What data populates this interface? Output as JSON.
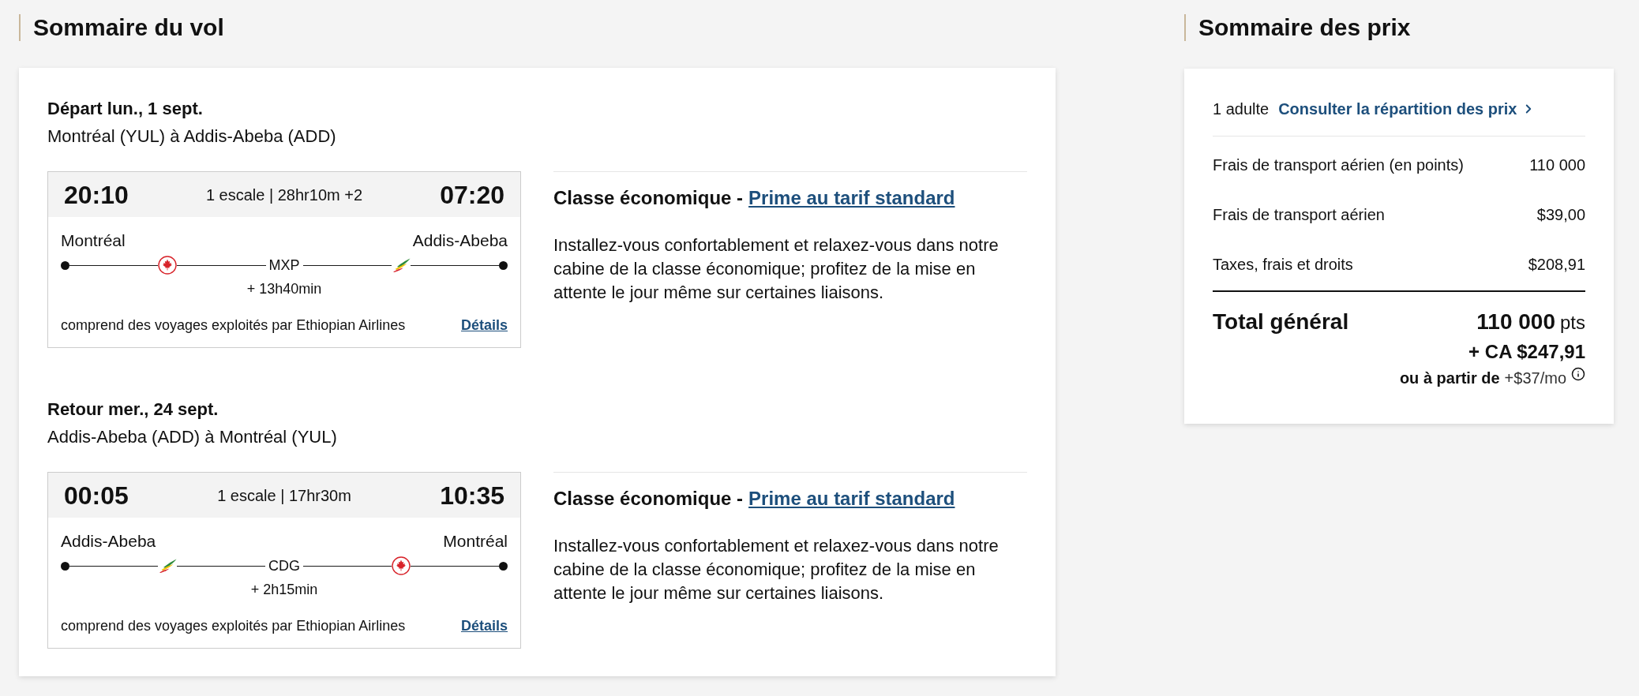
{
  "flight_summary": {
    "title": "Sommaire du vol",
    "bounds": [
      {
        "date": "Départ lun., 1 sept.",
        "route": "Montréal (YUL) à Addis-Abeba (ADD)",
        "departure_time": "20:10",
        "summary": "1 escale | 28hr10m +2",
        "arrival_time": "07:20",
        "origin": "Montréal",
        "destination": "Addis-Abeba",
        "legs": [
          {
            "kind": "leaf"
          },
          {
            "kind": "wing"
          }
        ],
        "stop": {
          "code": "MXP",
          "layover": "+ 13h40min"
        },
        "operator_note": "comprend des voyages exploités par Ethiopian Airlines",
        "details_link": "Détails",
        "cabin": "Classe économique -",
        "fare_link": "Prime au tarif standard",
        "description": "Installez-vous confortablement et relaxez-vous dans notre cabine de la classe économique; profitez de la mise en attente le jour même sur certaines liaisons."
      },
      {
        "date": "Retour mer., 24 sept.",
        "route": "Addis-Abeba (ADD) à Montréal (YUL)",
        "departure_time": "00:05",
        "summary": "1 escale | 17hr30m",
        "arrival_time": "10:35",
        "origin": "Addis-Abeba",
        "destination": "Montréal",
        "legs": [
          {
            "kind": "wing"
          },
          {
            "kind": "leaf"
          }
        ],
        "stop": {
          "code": "CDG",
          "layover": "+ 2h15min"
        },
        "operator_note": "comprend des voyages exploités par Ethiopian Airlines",
        "details_link": "Détails",
        "cabin": "Classe économique -",
        "fare_link": "Prime au tarif standard",
        "description": "Installez-vous confortablement et relaxez-vous dans notre cabine de la classe économique; profitez de la mise en attente le jour même sur certaines liaisons."
      }
    ]
  },
  "price_summary": {
    "title": "Sommaire des prix",
    "passengers": "1 adulte",
    "breakdown_link": "Consulter la répartition des prix",
    "lines": [
      {
        "label": "Frais de transport aérien (en points)",
        "amount": "110 000"
      },
      {
        "label": "Frais de transport aérien",
        "amount": "$39,00"
      },
      {
        "label": "Taxes, frais et droits",
        "amount": "$208,91"
      }
    ],
    "total": {
      "label": "Total général",
      "points": "110 000",
      "points_unit": "pts",
      "cash": "+ CA $247,91",
      "financing_prefix": "ou à partir de",
      "financing_amount": "+$37/mo"
    }
  }
}
